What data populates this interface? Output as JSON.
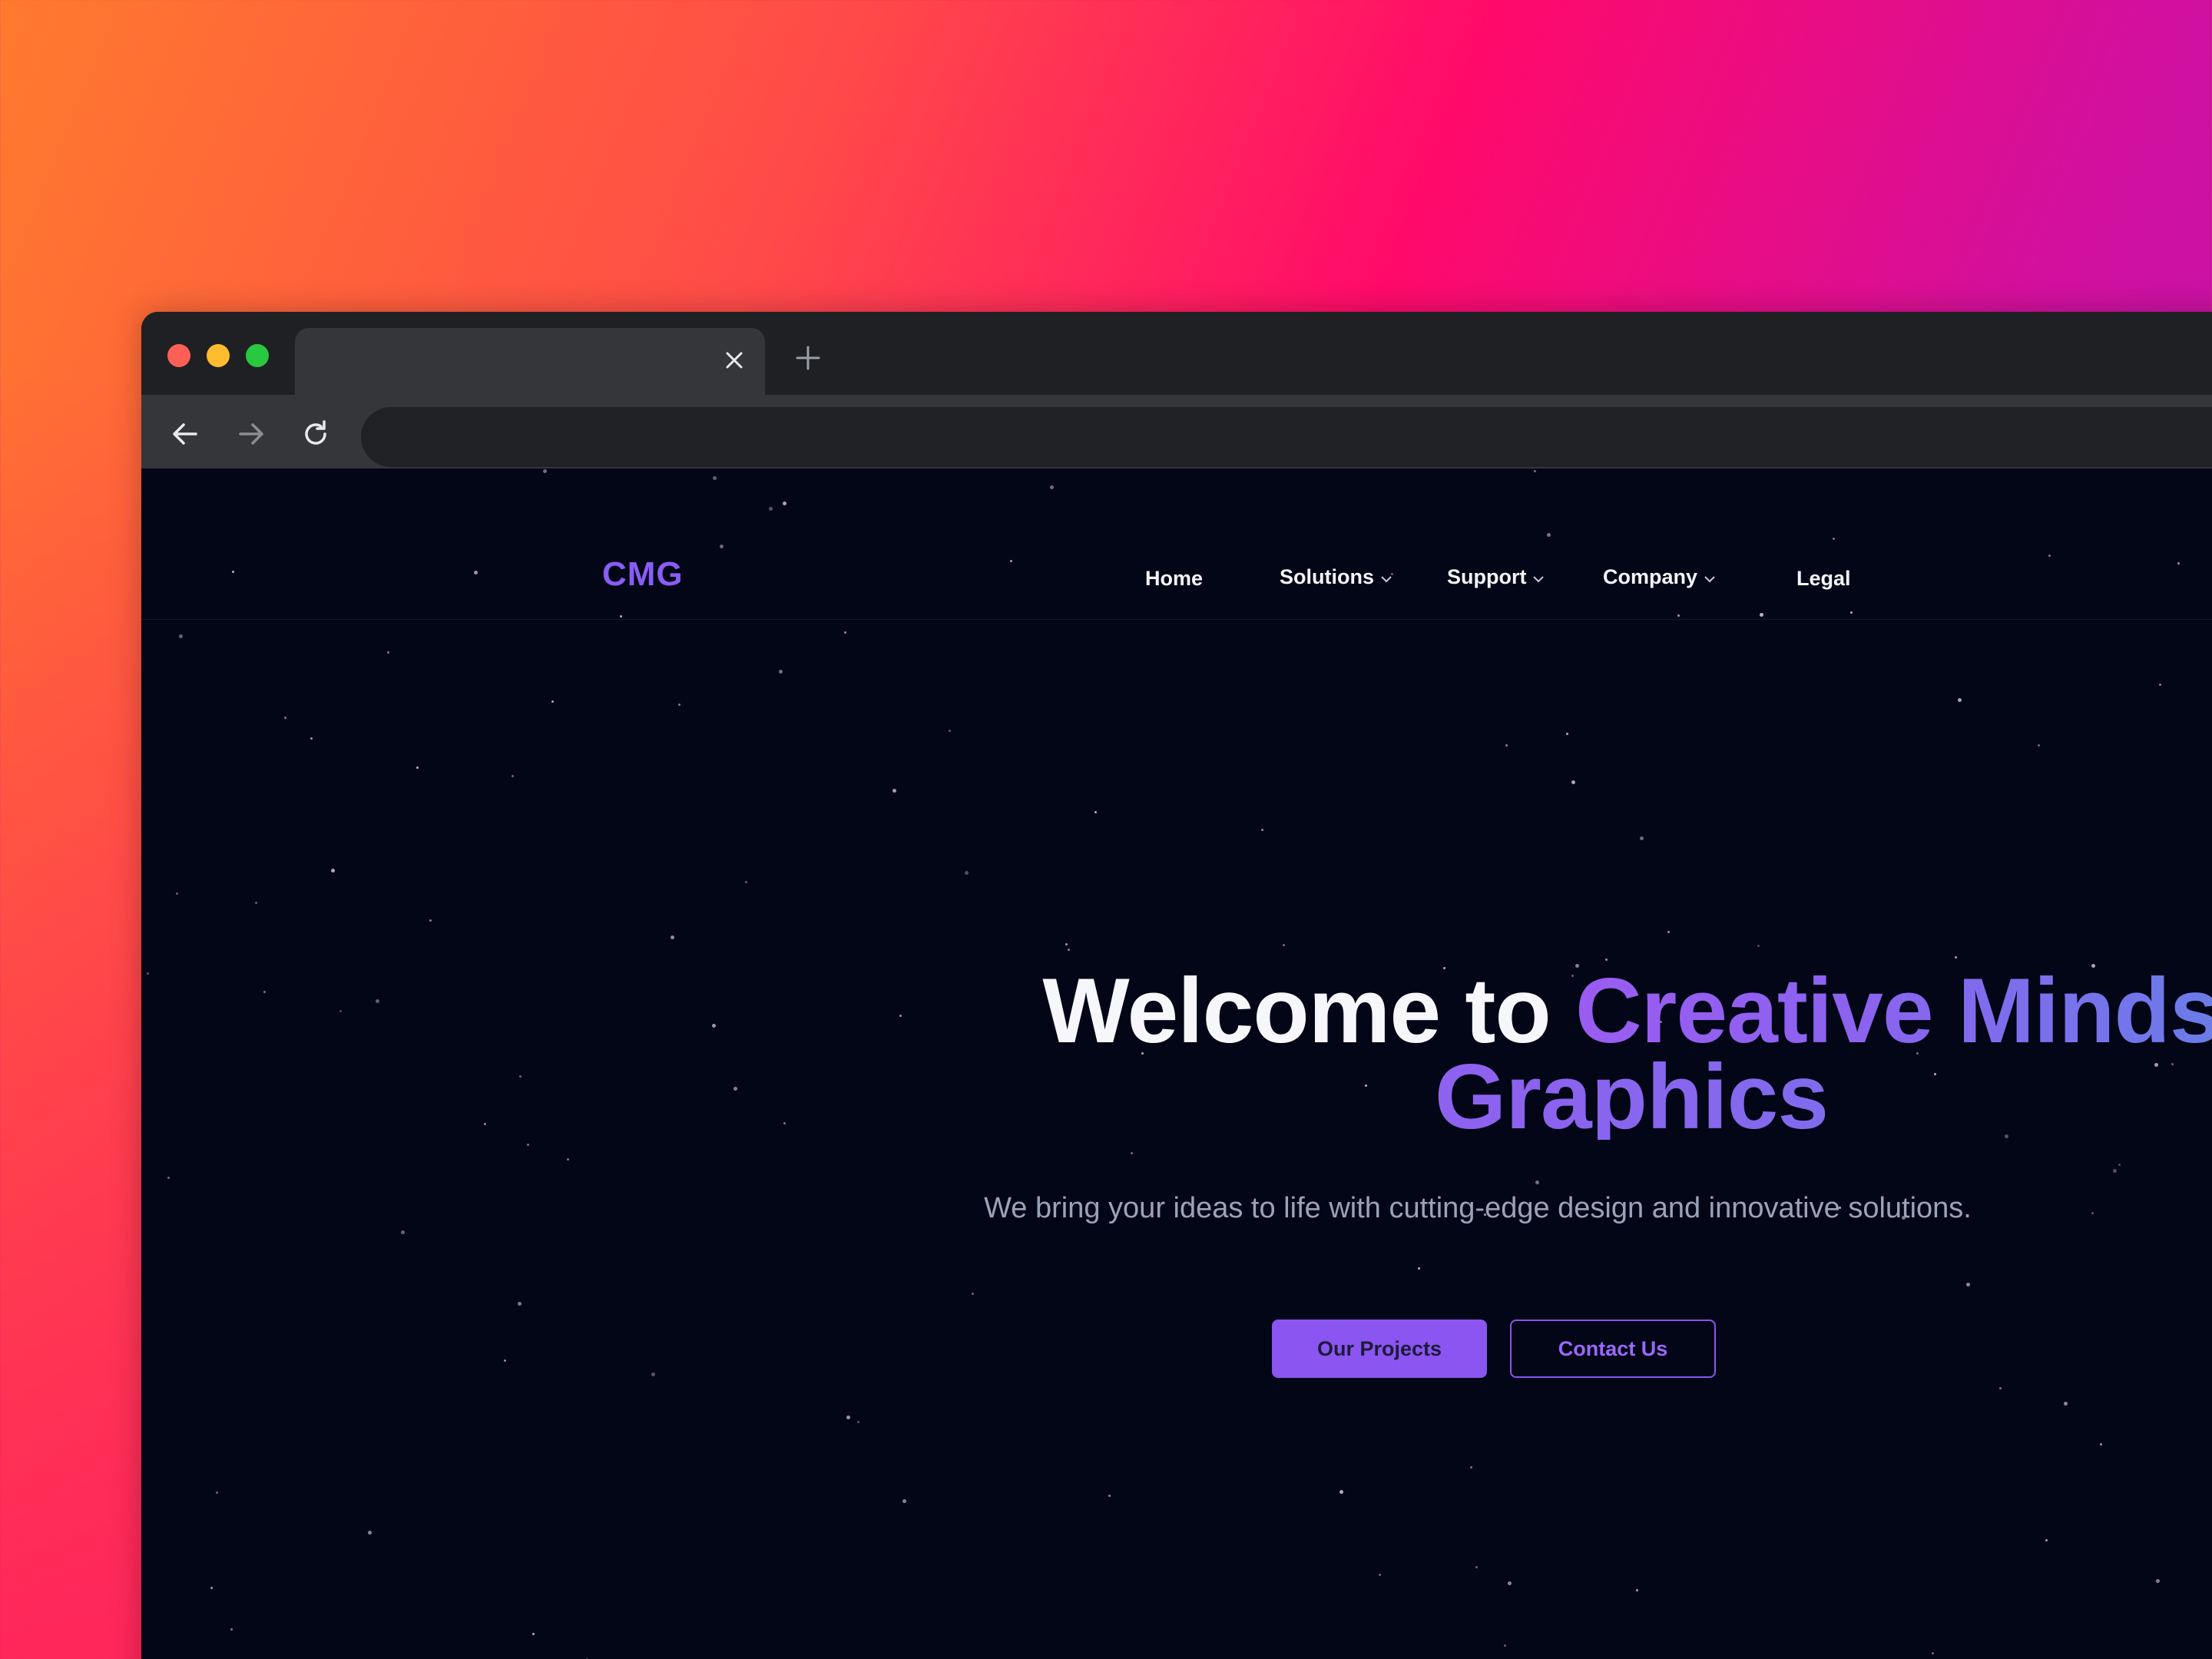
{
  "browser": {
    "tab_close_icon": "close-icon",
    "new_tab_icon": "plus-icon",
    "back_icon": "arrow-left-icon",
    "forward_icon": "arrow-right-icon",
    "reload_icon": "reload-icon",
    "address": ""
  },
  "site": {
    "logo": "CMG",
    "nav": {
      "home": "Home",
      "solutions": "Solutions",
      "support": "Support",
      "company": "Company",
      "legal": "Legal"
    },
    "hero": {
      "title_plain": "Welcome to",
      "title_accent_1": "Creative Minds",
      "title_accent_2": "Graphics",
      "subtitle": "We bring your ideas to life with cutting-edge design and innovative solutions.",
      "primary_cta": "Our Projects",
      "secondary_cta": "Contact Us"
    }
  },
  "colors": {
    "accent": "#8a55f0",
    "page_bg": "#030616",
    "window_chrome": "#35363a"
  }
}
